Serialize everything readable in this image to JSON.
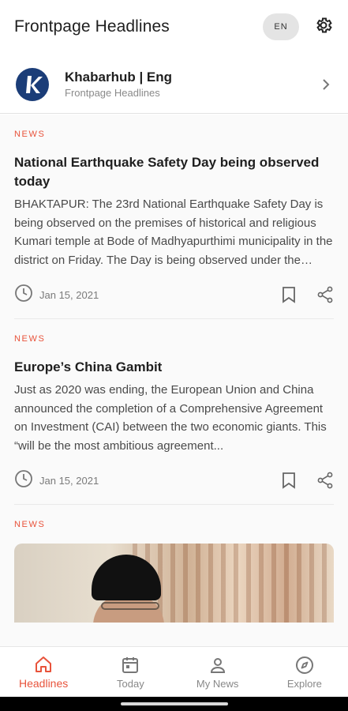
{
  "appbar": {
    "title": "Frontpage Headlines",
    "language": "EN"
  },
  "source": {
    "name": "Khabarhub | Eng",
    "subtitle": "Frontpage Headlines",
    "logo_letter": "k"
  },
  "articles": [
    {
      "tag": "NEWS",
      "headline": "National Earthquake Safety Day being observed today",
      "excerpt": "BHAKTAPUR: The 23rd National Earthquake Safety Day is being observed on the premises of historical and religious Kumari temple at Bode of Madhyapurthimi municipality in the district on Friday. The Day is being observed under the theme...",
      "date": "Jan 15, 2021"
    },
    {
      "tag": "NEWS",
      "headline": "Europe’s China Gambit",
      "excerpt": "Just as 2020 was ending, the European Union and China announced the completion of a Comprehensive Agreement on Investment (CAI) between the two economic giants. This “will be the most ambitious agreement...",
      "date": "Jan 15, 2021"
    },
    {
      "tag": "NEWS"
    }
  ],
  "bottom_nav": [
    {
      "label": "Headlines",
      "icon": "home-icon",
      "active": true
    },
    {
      "label": "Today",
      "icon": "calendar-icon",
      "active": false
    },
    {
      "label": "My News",
      "icon": "person-icon",
      "active": false
    },
    {
      "label": "Explore",
      "icon": "compass-icon",
      "active": false
    }
  ],
  "colors": {
    "accent": "#e8533b",
    "logo_bg": "#1b3d78",
    "text": "#1f1f1f",
    "muted": "#7a7a7a"
  }
}
